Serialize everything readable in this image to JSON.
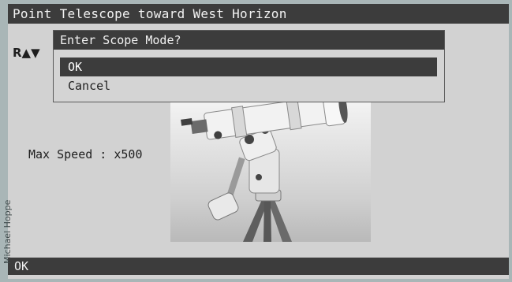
{
  "screen": {
    "title": "Point Telescope toward West Horizon",
    "ra_indicator": "R▲▼",
    "max_speed": "Max Speed : x500"
  },
  "dialog": {
    "title": "Enter Scope Mode?",
    "options": [
      {
        "label": "OK",
        "selected": true
      },
      {
        "label": "Cancel",
        "selected": false
      }
    ]
  },
  "status_bar": {
    "label": "OK"
  },
  "credit": "Michael Hoppe",
  "colors": {
    "bar": "#3c3c3c",
    "screen": "#d2d2d2",
    "frame": "#a9b6b7"
  }
}
